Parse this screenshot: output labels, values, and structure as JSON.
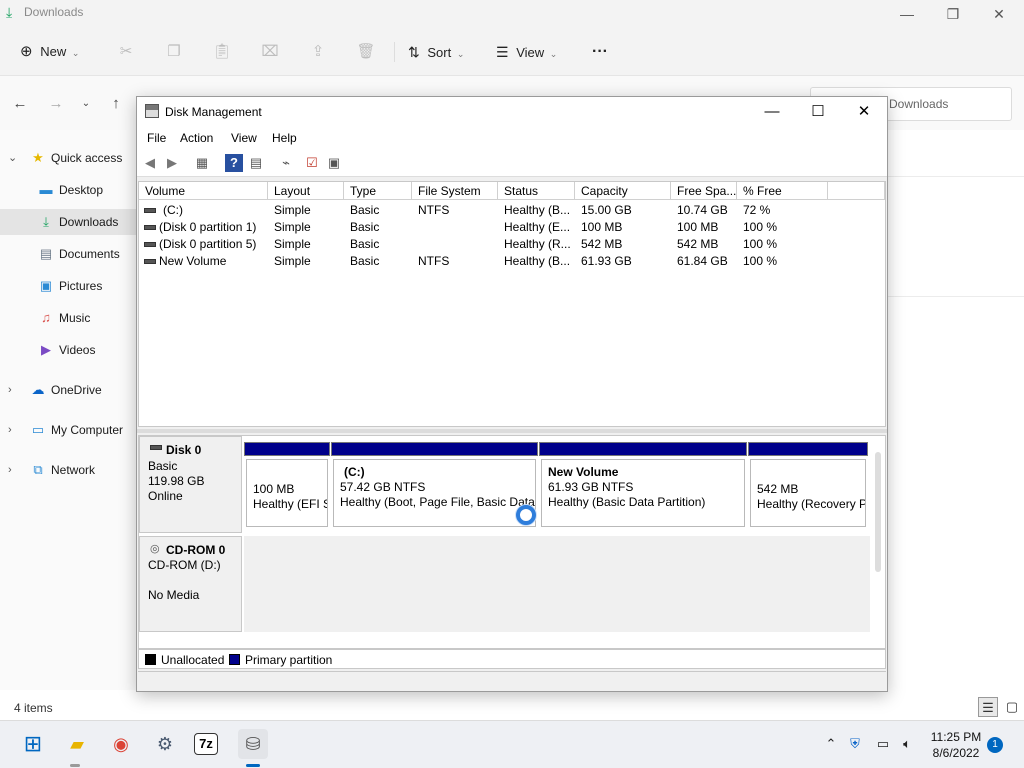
{
  "explorer": {
    "title": "Downloads",
    "toolbar": {
      "new_label": "New",
      "sort_label": "Sort",
      "view_label": "View",
      "more_label": "···"
    },
    "search_placeholder": "Downloads",
    "sidebar": [
      {
        "label": "Quick access",
        "icon": "star-icon"
      },
      {
        "label": "Desktop",
        "icon": "desktop-icon"
      },
      {
        "label": "Downloads",
        "icon": "download-icon"
      },
      {
        "label": "Documents",
        "icon": "document-icon"
      },
      {
        "label": "Pictures",
        "icon": "pictures-icon"
      },
      {
        "label": "Music",
        "icon": "music-icon"
      },
      {
        "label": "Videos",
        "icon": "videos-icon"
      },
      {
        "label": "OneDrive",
        "icon": "cloud-icon"
      },
      {
        "label": "My Computer",
        "icon": "computer-icon"
      },
      {
        "label": "Network",
        "icon": "network-icon"
      }
    ],
    "status": "4 items"
  },
  "disk_management": {
    "title": "Disk Management",
    "menu": [
      "File",
      "Action",
      "View",
      "Help"
    ],
    "columns": [
      "Volume",
      "Layout",
      "Type",
      "File System",
      "Status",
      "Capacity",
      "Free Spa...",
      "% Free"
    ],
    "volumes": [
      {
        "volume": "(C:)",
        "layout": "Simple",
        "type": "Basic",
        "fs": "NTFS",
        "status": "Healthy (B...",
        "capacity": "15.00 GB",
        "free": "10.74 GB",
        "pct": "72 %"
      },
      {
        "volume": "(Disk 0 partition 1)",
        "layout": "Simple",
        "type": "Basic",
        "fs": "",
        "status": "Healthy (E...",
        "capacity": "100 MB",
        "free": "100 MB",
        "pct": "100 %"
      },
      {
        "volume": "(Disk 0 partition 5)",
        "layout": "Simple",
        "type": "Basic",
        "fs": "",
        "status": "Healthy (R...",
        "capacity": "542 MB",
        "free": "542 MB",
        "pct": "100 %"
      },
      {
        "volume": "New Volume",
        "layout": "Simple",
        "type": "Basic",
        "fs": "NTFS",
        "status": "Healthy (B...",
        "capacity": "61.93 GB",
        "free": "61.84 GB",
        "pct": "100 %"
      }
    ],
    "disk0": {
      "name": "Disk 0",
      "type": "Basic",
      "size": "119.98 GB",
      "state": "Online",
      "partitions": [
        {
          "name": "",
          "size": "100 MB",
          "status": "Healthy (EFI S"
        },
        {
          "name": "(C:)",
          "size": "57.42 GB NTFS",
          "status": "Healthy (Boot, Page File, Basic Data P"
        },
        {
          "name": "New Volume",
          "size": "61.93 GB NTFS",
          "status": "Healthy (Basic Data Partition)"
        },
        {
          "name": "",
          "size": "542 MB",
          "status": "Healthy (Recovery P"
        }
      ]
    },
    "cdrom": {
      "name": "CD-ROM 0",
      "type": "CD-ROM (D:)",
      "state": "No Media"
    },
    "legend": [
      {
        "label": "Unallocated",
        "color": "#000000"
      },
      {
        "label": "Primary partition",
        "color": "#00008b"
      }
    ]
  },
  "taskbar": {
    "time": "11:25 PM",
    "date": "8/6/2022",
    "notification_count": "1",
    "apps": [
      "windows-start-icon",
      "file-explorer-icon",
      "chrome-icon",
      "settings-icon",
      "7zip-icon",
      "disk-management-icon"
    ],
    "sevenzip_label": "7z"
  },
  "colors": {
    "accent": "#0067c0",
    "primary_partition": "#00008b"
  }
}
